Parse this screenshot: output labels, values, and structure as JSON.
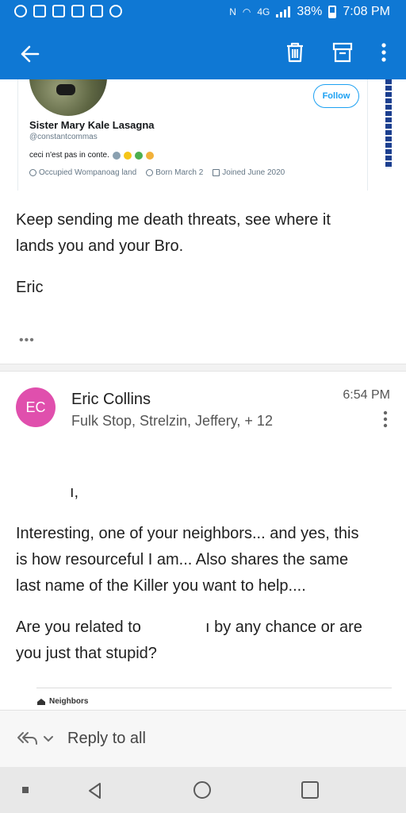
{
  "status_bar": {
    "battery": "38%",
    "time": "7:08 PM",
    "network": "4G"
  },
  "toolbar": {
    "back_icon": "back-arrow-icon",
    "delete_icon": "trash-icon",
    "archive_icon": "archive-icon",
    "more_icon": "more-vertical-icon"
  },
  "tweet": {
    "follow_label": "Follow",
    "name": "Sister Mary Kale Lasagna",
    "handle": "@constantcommas",
    "bio": "ceci n'est pas in conte.",
    "location": "Occupied Wompanoag land",
    "born": "Born March 2",
    "joined": "Joined June 2020"
  },
  "message1": {
    "body_line1": "Keep sending me death threats, see where it",
    "body_line2": "lands you and your Bro.",
    "signature": "Eric",
    "ellipsis": "•••"
  },
  "message2": {
    "avatar_initials": "EC",
    "avatar_color": "#e04fad",
    "sender": "Eric Collins",
    "recipients": "Fulk Stop, Strelzin, Jeffery, + 12",
    "time": "6:54 PM",
    "greeting": "ı,",
    "para1_line1": "Interesting, one of your neighbors... and yes, this",
    "para1_line2": "is how resourceful I am... Also shares the same",
    "para1_line3": "last name of the Killer you want to help....",
    "para2_line1_a": "Are you related to",
    "para2_line1_b": "ı by any chance or are",
    "para2_line2": "you just that stupid?",
    "quote_title": "Neighbors"
  },
  "reply_bar": {
    "label": "Reply to all"
  },
  "colors": {
    "app_bar": "#0f78d4",
    "accent_twitter": "#1da1f2"
  }
}
